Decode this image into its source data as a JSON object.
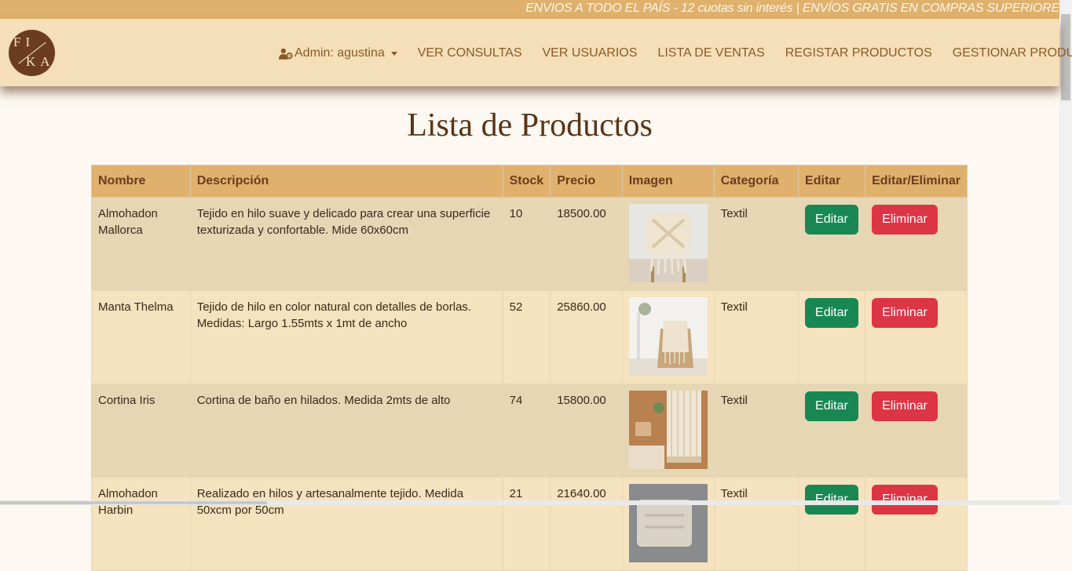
{
  "promo": {
    "text": "ENVIOS A TODO EL PAÍS - 12 cuotas sin interés | ENVÍOS GRATIS EN COMPRAS SUPERIORE"
  },
  "logo": {
    "line1": "FI",
    "line2": "KA"
  },
  "nav": {
    "admin": "Admin: agustina",
    "items": [
      "VER CONSULTAS",
      "VER USUARIOS",
      "LISTA DE VENTAS",
      "REGISTAR PRODUCTOS",
      "GESTIONAR PRODUCTOS"
    ]
  },
  "page": {
    "title": "Lista de Productos"
  },
  "table": {
    "headers": [
      "Nombre",
      "Descripción",
      "Stock",
      "Precio",
      "Imagen",
      "Categoría",
      "Editar",
      "Editar/Eliminar"
    ],
    "rows": [
      {
        "nombre": "Almohadon Mallorca",
        "descripcion": "Tejido en hilo suave y delicado para crear una superficie texturizada y confortable. Mide 60x60cm",
        "stock": "10",
        "precio": "18500.00",
        "categoria": "Textil",
        "editar": "Editar",
        "eliminar": "Eliminar"
      },
      {
        "nombre": "Manta Thelma",
        "descripcion": "Tejido de hilo en color natural con detalles de borlas. Medidas: Largo 1.55mts x 1mt de ancho",
        "stock": "52",
        "precio": "25860.00",
        "categoria": "Textil",
        "editar": "Editar",
        "eliminar": "Eliminar"
      },
      {
        "nombre": "Cortina Iris",
        "descripcion": "Cortina de baño en hilados. Medida 2mts de alto",
        "stock": "74",
        "precio": "15800.00",
        "categoria": "Textil",
        "editar": "Editar",
        "eliminar": "Eliminar"
      },
      {
        "nombre": "Almohadon Harbin",
        "descripcion": "Realizado en hilos y artesanalmente tejido. Medida 50xcm por 50cm",
        "stock": "21",
        "precio": "21640.00",
        "categoria": "Textil",
        "editar": "Editar",
        "eliminar": "Eliminar"
      }
    ]
  },
  "colors": {
    "accent": "#dfb16d",
    "navbar": "#f5dfb8",
    "brown": "#6b3d1e",
    "edit": "#198754",
    "delete": "#dc3545"
  }
}
